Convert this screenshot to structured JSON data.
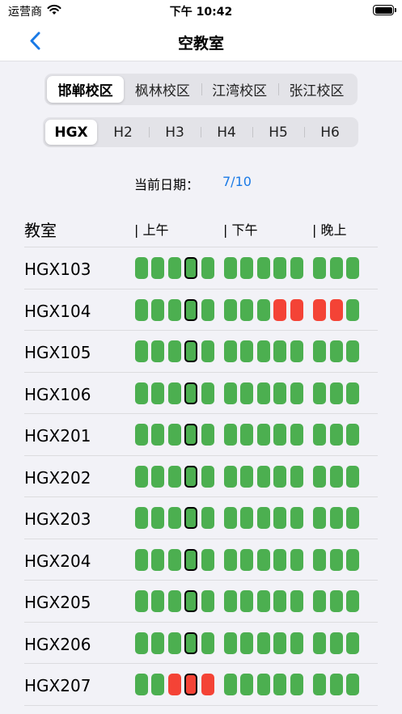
{
  "status_bar": {
    "carrier": "运营商",
    "time": "下午 10:42",
    "battery_level": 1.0
  },
  "nav": {
    "title": "空教室",
    "back_icon": "chevron-left-icon"
  },
  "campus_tabs": [
    "邯郸校区",
    "枫林校区",
    "江湾校区",
    "张江校区"
  ],
  "campus_selected": 0,
  "building_tabs": [
    "HGX",
    "H2",
    "H3",
    "H4",
    "H5",
    "H6"
  ],
  "building_selected": 0,
  "date": {
    "label": "当前日期：",
    "value": "7/10"
  },
  "table": {
    "room_header": "教室",
    "period_headers": [
      "| 上午",
      "| 下午",
      "| 晚上"
    ],
    "current_slot": 3,
    "rooms": [
      {
        "name": "HGX103",
        "slots": "0000000000000"
      },
      {
        "name": "HGX104",
        "slots": "0000000011110"
      },
      {
        "name": "HGX105",
        "slots": "0000000000000"
      },
      {
        "name": "HGX106",
        "slots": "0000000000000"
      },
      {
        "name": "HGX201",
        "slots": "0000000000000"
      },
      {
        "name": "HGX202",
        "slots": "0000000000000"
      },
      {
        "name": "HGX203",
        "slots": "0000000000000"
      },
      {
        "name": "HGX204",
        "slots": "0000000000000"
      },
      {
        "name": "HGX205",
        "slots": "0000000000000"
      },
      {
        "name": "HGX206",
        "slots": "0000000000000"
      },
      {
        "name": "HGX207",
        "slots": "0011100000000"
      }
    ]
  },
  "colors": {
    "free": "#4caf50",
    "occupied": "#f44336",
    "accent": "#1a7ae6"
  }
}
